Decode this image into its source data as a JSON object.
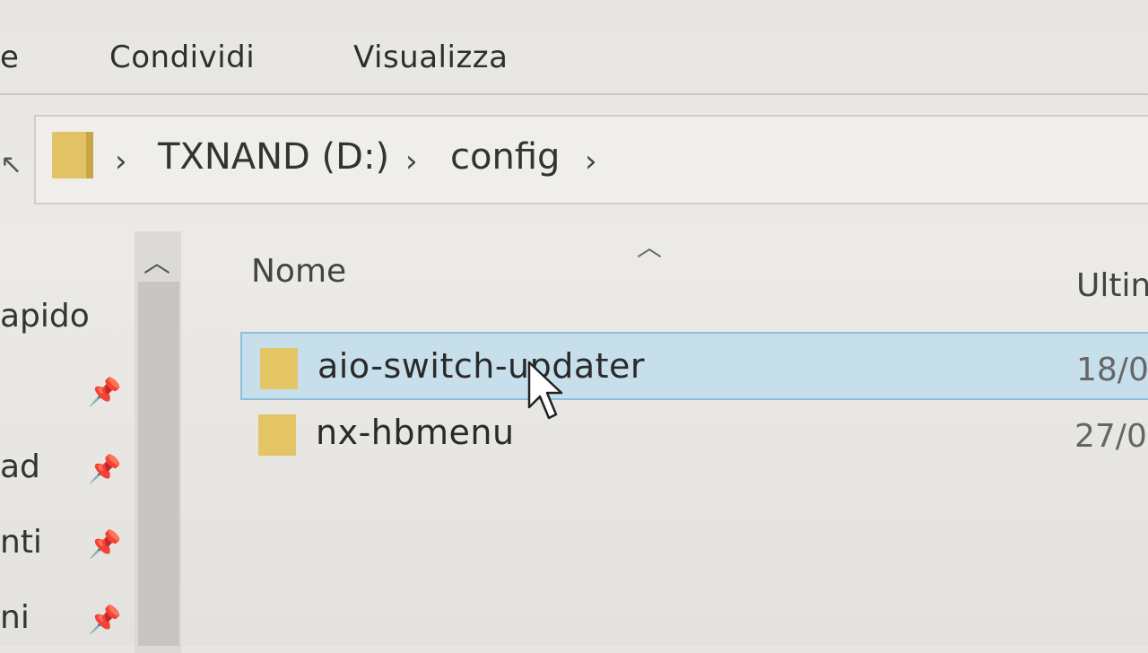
{
  "ribbon": {
    "tabs": [
      {
        "label": "e"
      },
      {
        "label": "Condividi"
      },
      {
        "label": "Visualizza"
      }
    ]
  },
  "address": {
    "separator": "›",
    "crumbs": [
      "TXNAND (D:)",
      "config"
    ]
  },
  "nav": {
    "items": [
      {
        "label": "apido",
        "pinned": false
      },
      {
        "label": "",
        "pinned": true
      },
      {
        "label": "ad",
        "pinned": true
      },
      {
        "label": "nti",
        "pinned": true
      },
      {
        "label": "ni",
        "pinned": true
      }
    ]
  },
  "columns": {
    "name": "Nome",
    "modified": "Ultin"
  },
  "files": [
    {
      "name": "aio-switch-updater",
      "date": "18/0",
      "selected": true
    },
    {
      "name": "nx-hbmenu",
      "date": "27/0",
      "selected": false
    }
  ],
  "icons": {
    "folder": "folder-icon",
    "pin": "pin-icon",
    "sort": "sort-ascending-icon",
    "cursor": "mouse-cursor-icon"
  },
  "colors": {
    "folder": "#e1c264",
    "selection": "#c6dfea",
    "selection_border": "#8fc0db"
  }
}
